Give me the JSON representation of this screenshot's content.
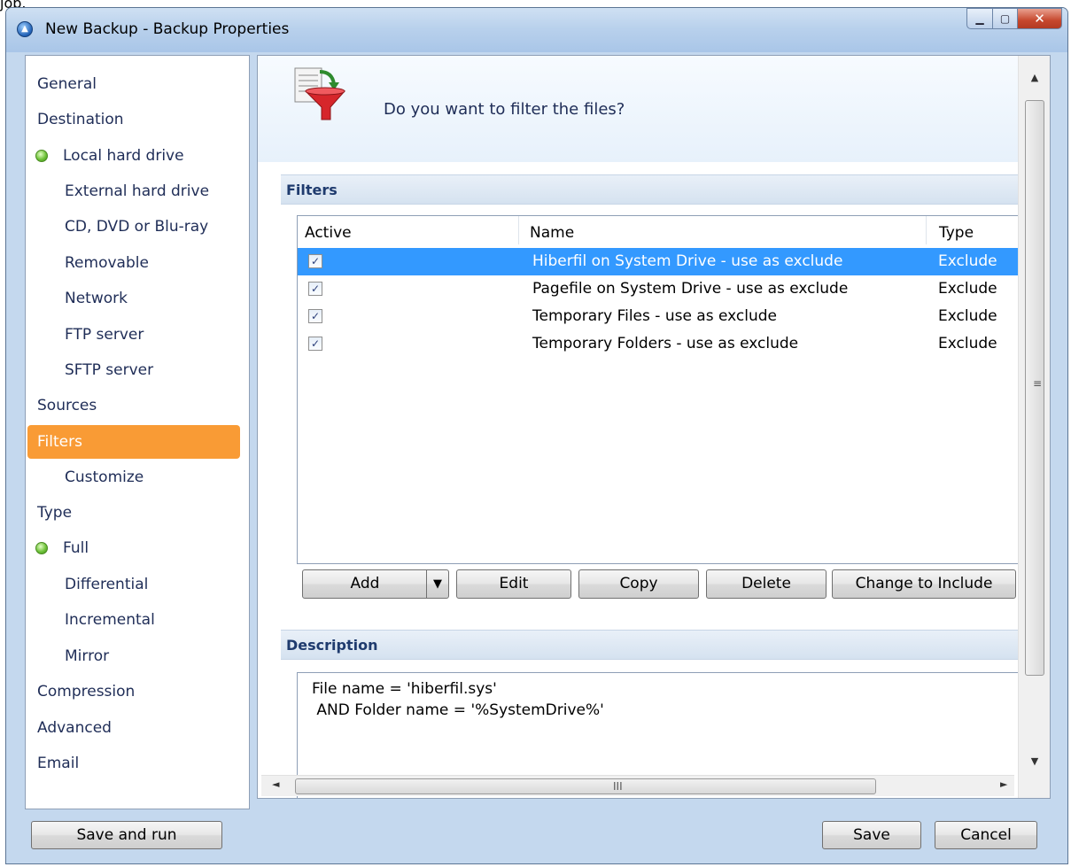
{
  "window": {
    "title": "New Backup - Backup Properties",
    "stray_text": "job."
  },
  "sidebar": {
    "items": [
      {
        "label": "General",
        "level": "top"
      },
      {
        "label": "Destination",
        "level": "top"
      },
      {
        "label": "Local hard drive",
        "level": "radio"
      },
      {
        "label": "External hard drive",
        "level": "sub"
      },
      {
        "label": "CD, DVD or Blu-ray",
        "level": "sub"
      },
      {
        "label": "Removable",
        "level": "sub"
      },
      {
        "label": "Network",
        "level": "sub"
      },
      {
        "label": "FTP server",
        "level": "sub"
      },
      {
        "label": "SFTP server",
        "level": "sub"
      },
      {
        "label": "Sources",
        "level": "top"
      },
      {
        "label": "Filters",
        "level": "top",
        "selected": true
      },
      {
        "label": "Customize",
        "level": "sub"
      },
      {
        "label": "Type",
        "level": "top"
      },
      {
        "label": "Full",
        "level": "radio"
      },
      {
        "label": "Differential",
        "level": "sub"
      },
      {
        "label": "Incremental",
        "level": "sub"
      },
      {
        "label": "Mirror",
        "level": "sub"
      },
      {
        "label": "Compression",
        "level": "top"
      },
      {
        "label": "Advanced",
        "level": "top"
      },
      {
        "label": "Email",
        "level": "top"
      }
    ],
    "selected_color": "#f99b35"
  },
  "header": {
    "question": "Do you want to filter the files?"
  },
  "filters": {
    "section_title": "Filters",
    "columns": [
      "Active",
      "Name",
      "Type"
    ],
    "rows": [
      {
        "active": true,
        "name": "Hiberfil on System Drive - use as exclude",
        "type": "Exclude",
        "selected": true
      },
      {
        "active": true,
        "name": "Pagefile on System Drive - use as exclude",
        "type": "Exclude"
      },
      {
        "active": true,
        "name": "Temporary Files - use as exclude",
        "type": "Exclude"
      },
      {
        "active": true,
        "name": "Temporary Folders - use as exclude",
        "type": "Exclude"
      }
    ],
    "buttons": {
      "add": "Add",
      "edit": "Edit",
      "copy": "Copy",
      "delete": "Delete",
      "change": "Change to Include"
    }
  },
  "description": {
    "section_title": "Description",
    "lines": [
      "File name = 'hiberfil.sys'",
      " AND Folder name = '%SystemDrive%'"
    ]
  },
  "footer": {
    "save_and_run": "Save and run",
    "save": "Save",
    "cancel": "Cancel"
  },
  "colors": {
    "selection_blue": "#3399ff",
    "section_header_text": "#1f3b6e"
  }
}
